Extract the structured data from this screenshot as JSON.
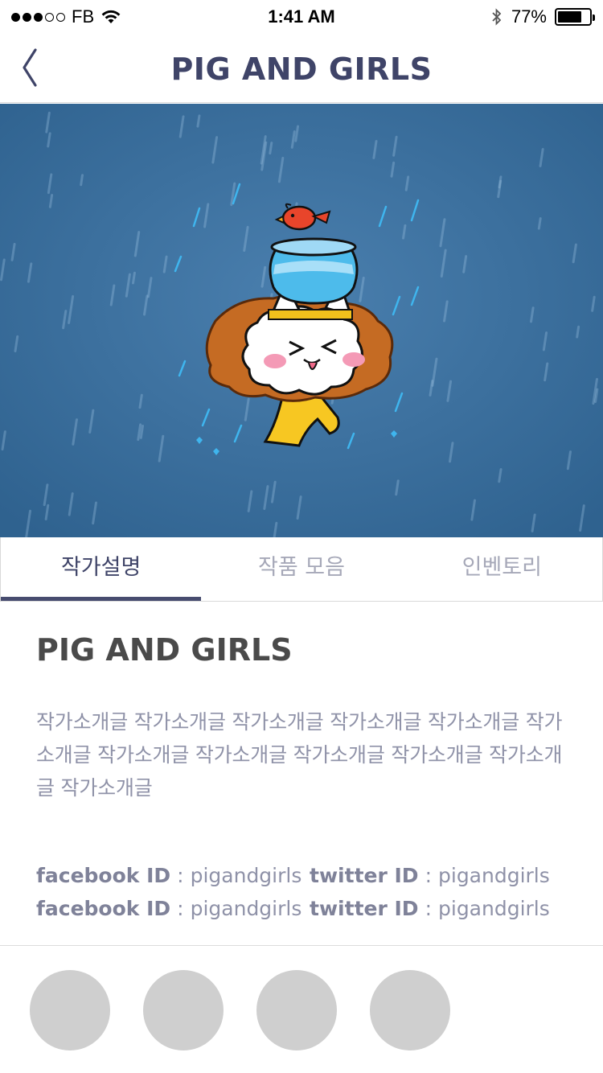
{
  "status_bar": {
    "carrier": "FB",
    "time": "1:41 AM",
    "battery_percent": "77%",
    "battery_level": 0.77,
    "signal_filled": 3,
    "signal_total": 5
  },
  "nav": {
    "title": "PIG AND GIRLS",
    "back_icon": "chevron-left-icon"
  },
  "colors": {
    "accent": "#474c6f",
    "hero_bg": "#3a6f9e",
    "placeholder": "#cfcfcf"
  },
  "tabs": [
    {
      "label": "작가설명",
      "active": true
    },
    {
      "label": "작품 모음",
      "active": false
    },
    {
      "label": "인벤토리",
      "active": false
    }
  ],
  "artist": {
    "name": "PIG AND GIRLS",
    "description": "작가소개글 작가소개글 작가소개글 작가소개글 작가소개글 작가소개글 작가소개글 작가소개글 작가소개글 작가소개글 작가소개글 작가소개글"
  },
  "sns": [
    [
      {
        "label": "facebook ID",
        "sep": ":",
        "value": "pigandgirls"
      },
      {
        "label": "twitter ID",
        "sep": ":",
        "value": "pigandgirls"
      }
    ],
    [
      {
        "label": "facebook ID",
        "sep": ":",
        "value": "pigandgirls"
      },
      {
        "label": "twitter ID",
        "sep": ":",
        "value": "pigandgirls"
      }
    ]
  ]
}
